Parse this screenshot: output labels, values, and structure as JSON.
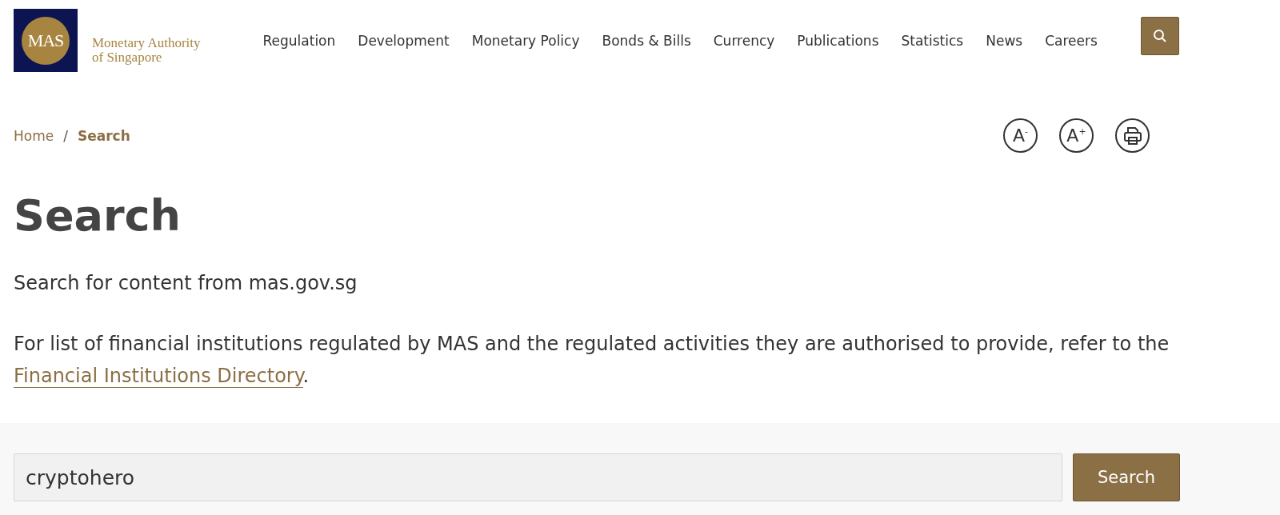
{
  "logo": {
    "mark": "MAS",
    "name_lines": [
      "Monetary Authority",
      "of Singapore"
    ]
  },
  "nav": [
    "Regulation",
    "Development",
    "Monetary Policy",
    "Bonds & Bills",
    "Currency",
    "Publications",
    "Statistics",
    "News",
    "Careers"
  ],
  "breadcrumb_separator": "/",
  "breadcrumb": [
    {
      "label": "Home",
      "current": false
    },
    {
      "label": "Search",
      "current": true
    }
  ],
  "text_size_buttons": [
    {
      "letter": "A",
      "sign": "-"
    },
    {
      "letter": "A",
      "sign": "+"
    }
  ],
  "heading": "Search",
  "intro": "Search for content from mas.gov.sg",
  "note": {
    "text": "For list of financial institutions regulated by MAS and the regulated activities they are authorised to provide, refer to the",
    "link": "Financial Institutions Directory",
    "end": "."
  },
  "search": {
    "value": "cryptohero",
    "button": "Search"
  }
}
